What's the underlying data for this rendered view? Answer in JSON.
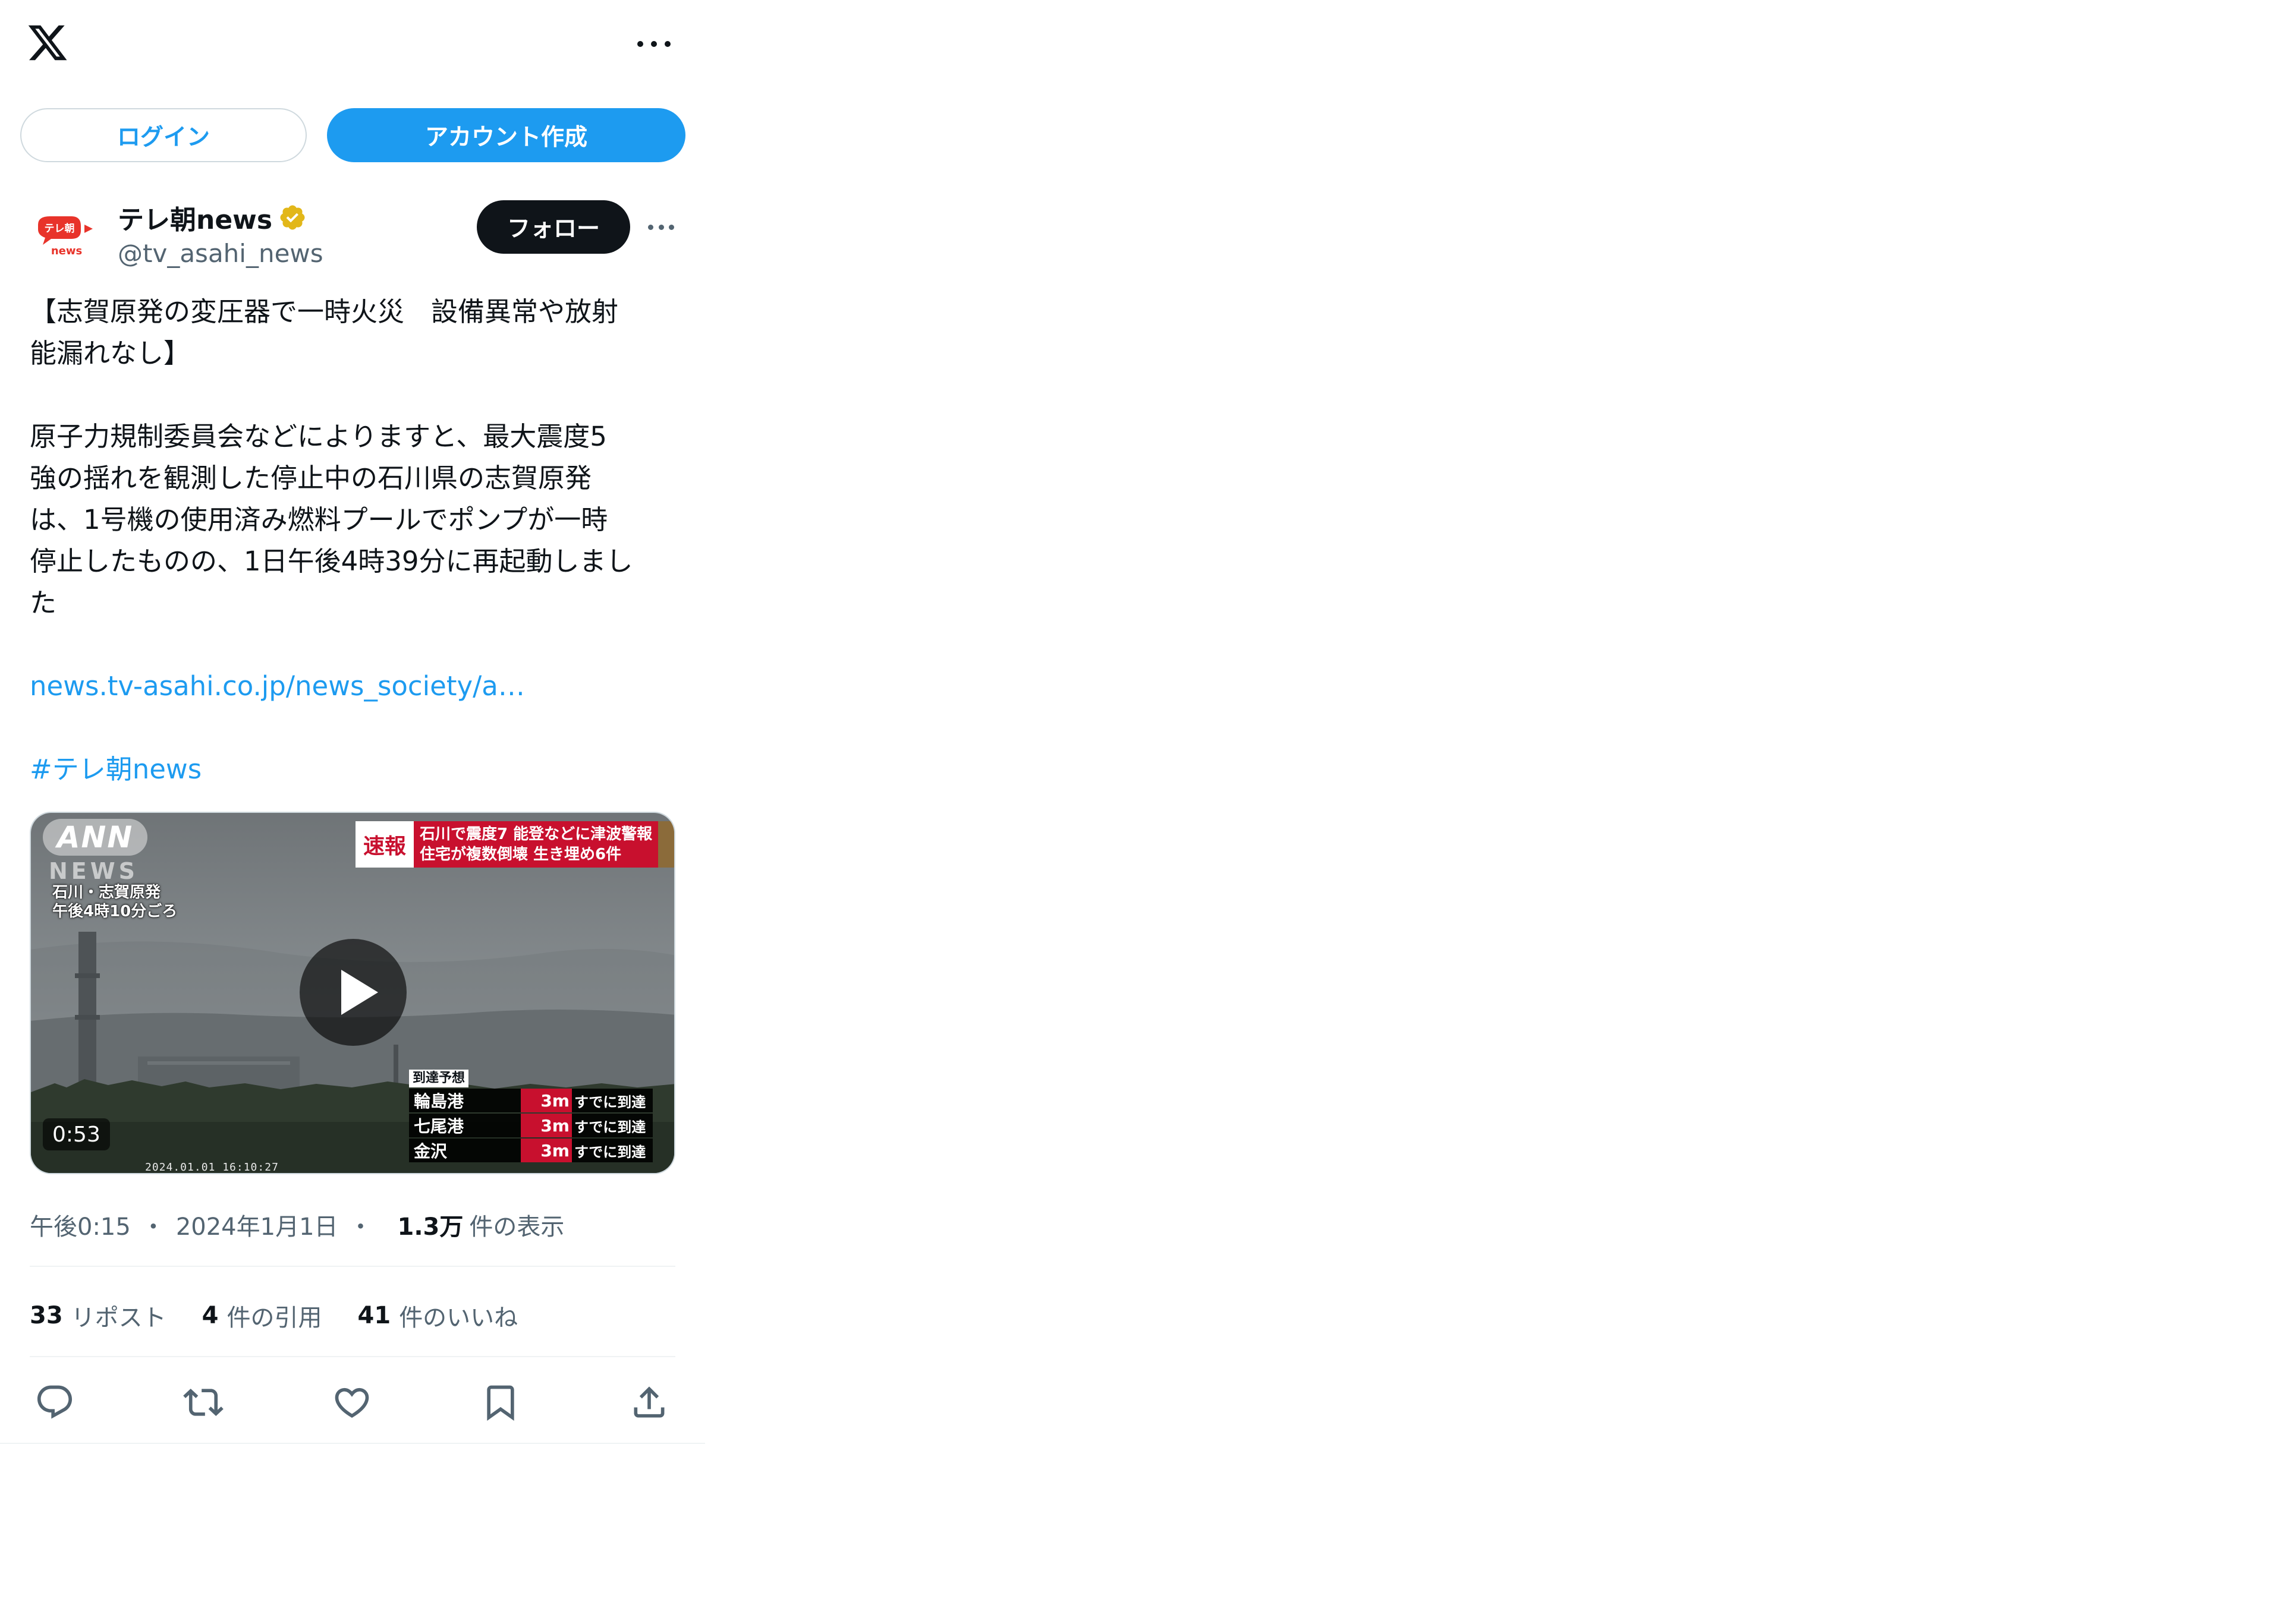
{
  "header": {
    "logo_icon": "x-logo-icon",
    "more_icon": "more-horizontal-icon"
  },
  "auth": {
    "login_label": "ログイン",
    "signup_label": "アカウント作成"
  },
  "author": {
    "avatar_text_top": "テレ朝",
    "avatar_text_bottom": "news",
    "name": "テレ朝news",
    "verified_icon": "verified-badge-icon",
    "handle": "@tv_asahi_news",
    "follow_label": "フォロー"
  },
  "tweet": {
    "title_line1": "【志賀原発の変圧器で一時火災　設備異常や放射",
    "title_line2": "能漏れなし】",
    "body_line1": "原子力規制委員会などによりますと、最大震度5",
    "body_line2": "強の揺れを観測した停止中の石川県の志賀原発",
    "body_line3": "は、1号機の使用済み燃料プールでポンプが一時",
    "body_line4": "停止したものの、1日午後4時39分に再起動しまし",
    "body_line5": "た",
    "link": "news.tv-asahi.co.jp/news_society/a…",
    "hashtag": "#テレ朝news"
  },
  "media": {
    "ann_logo": "ANN",
    "ann_news": "NEWS",
    "location_line1": "石川・志賀原発",
    "location_line2": "午後4時10分ごろ",
    "flash_tag": "速報",
    "flash_line1": "石川で震度7 能登などに津波警報",
    "flash_line2": "住宅が複数倒壊 生き埋め6件",
    "tsunami_header": "到達予想",
    "tsunami_rows": [
      {
        "port": "輪島港",
        "height": "3m",
        "status": "すでに到達"
      },
      {
        "port": "七尾港",
        "height": "3m",
        "status": "すでに到達"
      },
      {
        "port": "金沢",
        "height": "3m",
        "status": "すでに到達"
      }
    ],
    "timestamp": "2024.01.01 16:10:27",
    "duration": "0:53",
    "play_icon": "play-icon"
  },
  "meta": {
    "time": "午後0:15",
    "separator": "・",
    "date": "2024年1月1日",
    "separator2": "・",
    "views_value": "1.3万",
    "views_label": "件の表示"
  },
  "stats": {
    "reposts_value": "33",
    "reposts_label": "リポスト",
    "quotes_value": "4",
    "quotes_label": "件の引用",
    "likes_value": "41",
    "likes_label": "件のいいね"
  },
  "actions": [
    "reply-icon",
    "repost-icon",
    "like-icon",
    "bookmark-icon",
    "share-icon"
  ],
  "colors": {
    "accent": "#1d9bf0",
    "text": "#0f1419",
    "muted": "#536471",
    "border": "#cfd9de",
    "breaking_red": "#c8102e",
    "verified_gold": "#e2b719"
  }
}
